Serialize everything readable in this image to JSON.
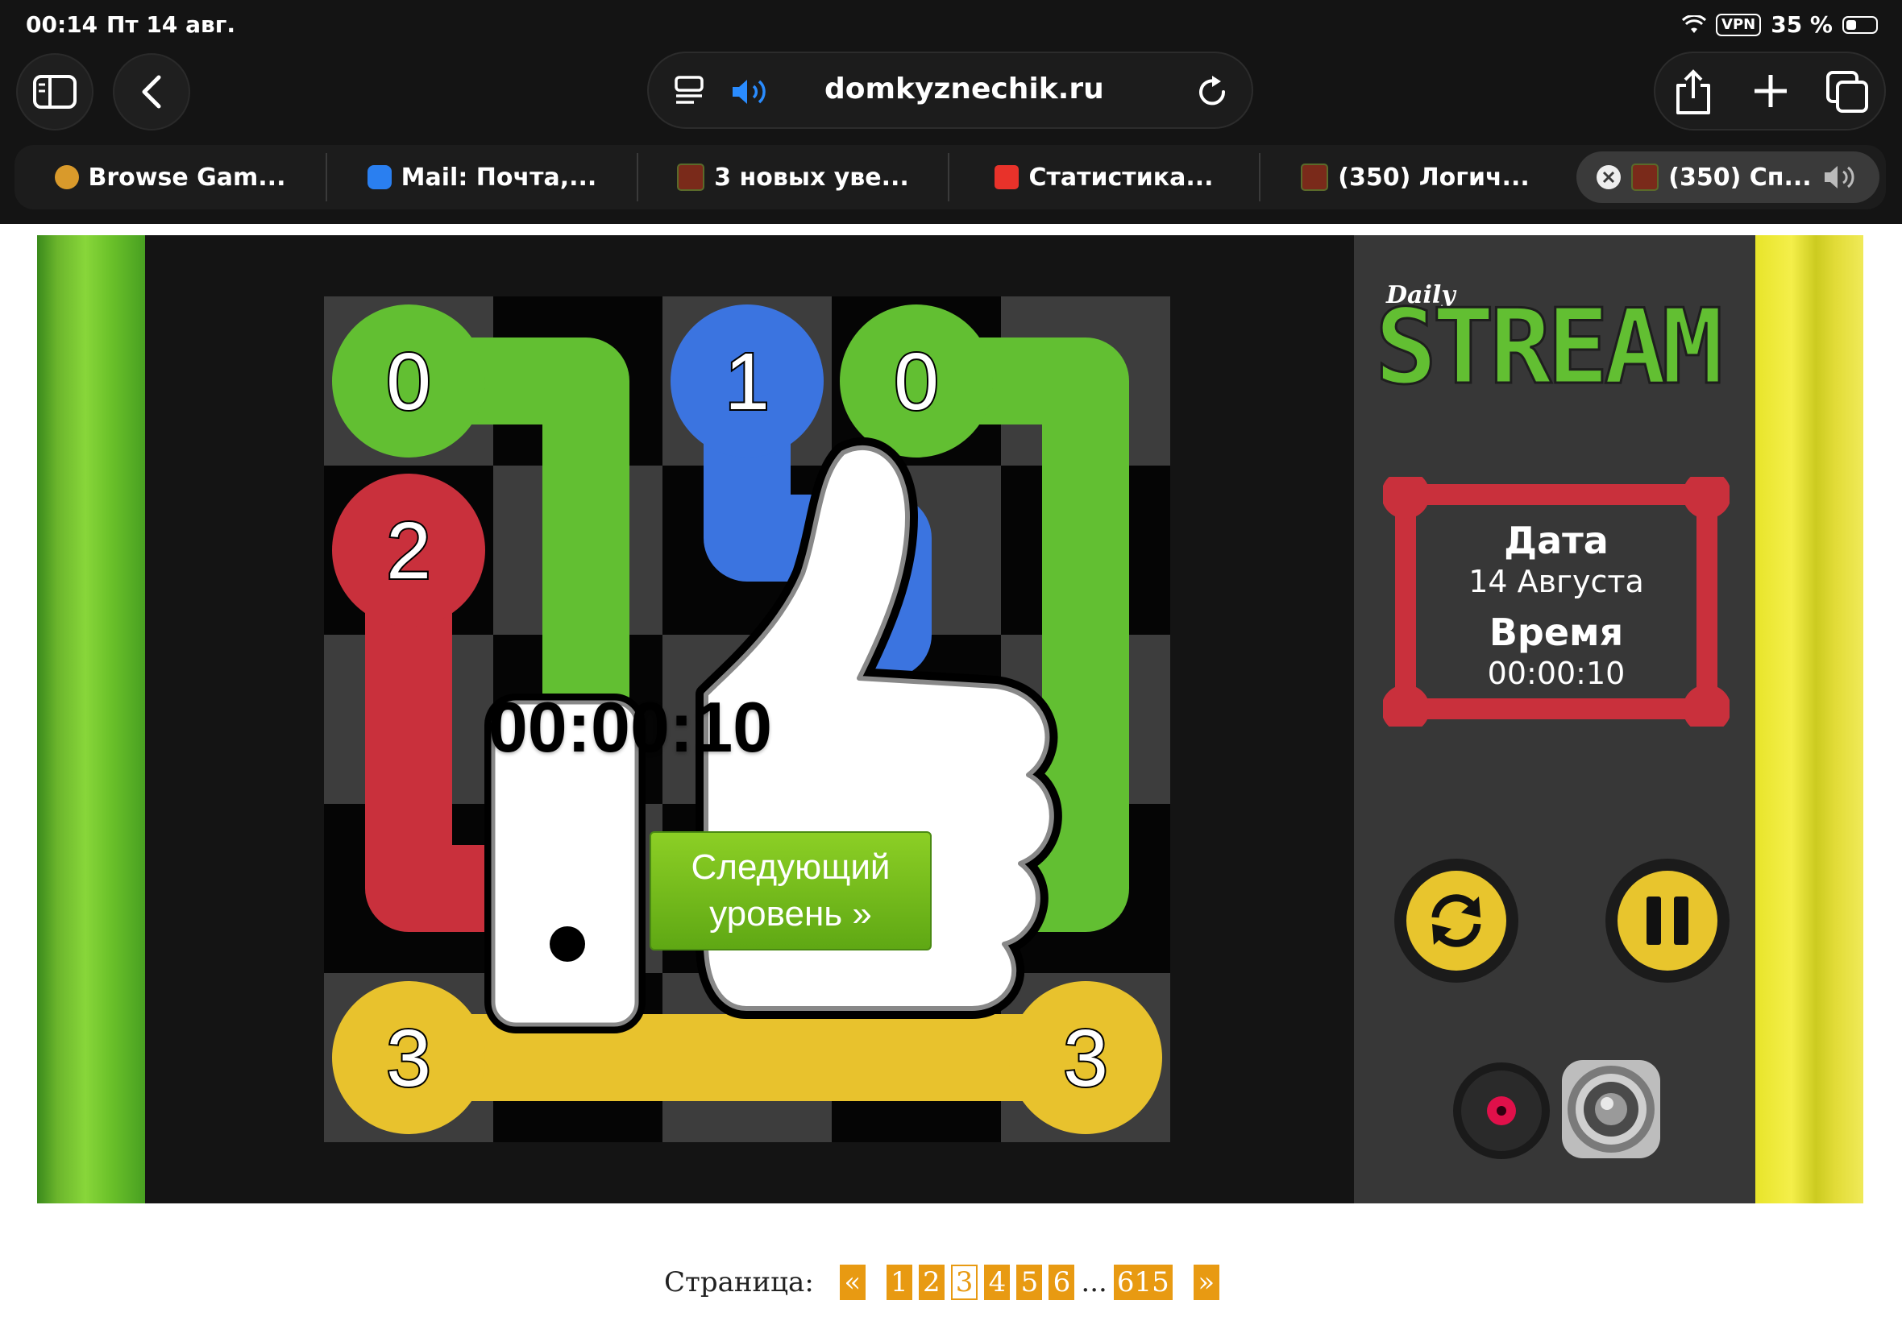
{
  "status_bar": {
    "time": "00:14",
    "date": "Пт 14 авг.",
    "vpn": "VPN",
    "battery": "35 %"
  },
  "browser": {
    "url": "domkyznechik.ru",
    "tabs": [
      {
        "label": "Browse Gam..."
      },
      {
        "label": "Mail: Почта,..."
      },
      {
        "label": "3 новых уве..."
      },
      {
        "label": "Статистика..."
      },
      {
        "label": "(350) Логич..."
      },
      {
        "label": "(350) Сп..."
      }
    ]
  },
  "game": {
    "logo_small": "Daily",
    "logo_big": "STREAM",
    "date_label": "Дата",
    "date_value": "14 Августа",
    "time_label": "Время",
    "time_value": "00:00:10",
    "result_time": "00:00:10",
    "next_button": {
      "line1": "Следующий",
      "line2": "уровень »"
    },
    "endpoints": [
      "0",
      "1",
      "0",
      "2",
      "3",
      "3"
    ],
    "colors": {
      "green": "#62bf32",
      "blue": "#3b74e0",
      "red": "#c9303c",
      "yellow": "#e8c22d"
    }
  },
  "pagination": {
    "label": "Страница:",
    "prev": "«",
    "pages": [
      "1",
      "2",
      "3",
      "4",
      "5",
      "6"
    ],
    "current": "3",
    "ellipsis": "...",
    "last": "615",
    "next": "»"
  }
}
